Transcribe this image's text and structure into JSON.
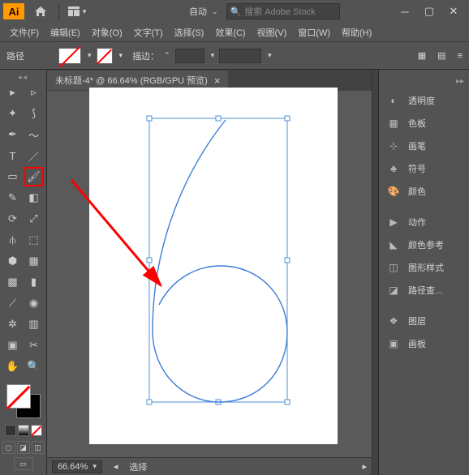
{
  "titlebar": {
    "logo": "Ai",
    "auto_label": "自动",
    "search_placeholder": "搜索 Adobe Stock"
  },
  "menu": {
    "file": "文件(F)",
    "edit": "编辑(E)",
    "object": "对象(O)",
    "type": "文字(T)",
    "select": "选择(S)",
    "effect": "效果(C)",
    "view": "视图(V)",
    "window": "窗口(W)",
    "help": "帮助(H)"
  },
  "options": {
    "path_label": "路径",
    "stroke_label": "描边：",
    "stroke_value": ""
  },
  "document": {
    "tab_title": "未标题-4* @ 66.64% (RGB/GPU 预览)",
    "zoom": "66.64%",
    "status_mode": "选择"
  },
  "panels": {
    "transparency": "透明度",
    "swatches": "色板",
    "brushes": "画笔",
    "symbols": "符号",
    "color": "颜色",
    "actions": "动作",
    "color_guide": "颜色参考",
    "graphic_styles": "图形样式",
    "path_lookup": "路径查...",
    "layers": "图层",
    "artboards": "画板"
  }
}
